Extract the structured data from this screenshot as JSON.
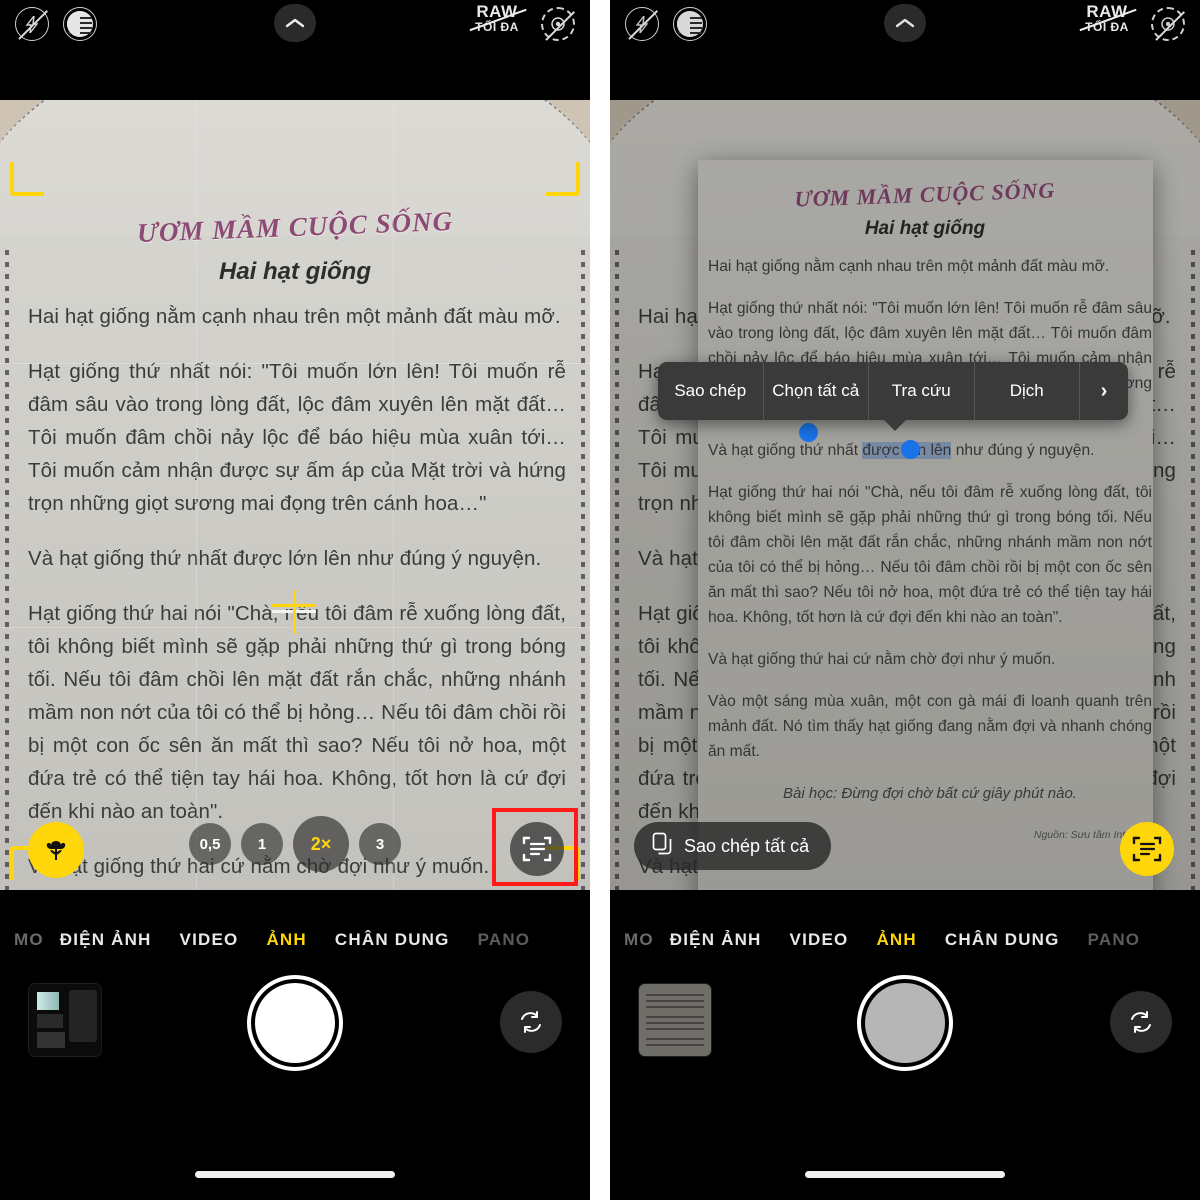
{
  "app": {
    "name": "Camera",
    "accent_yellow": "#FFD60A",
    "selection_blue": "#1A73E8",
    "highlight_red": "#FF1A1A"
  },
  "topbar": {
    "flash_off_icon": "flash-off-icon",
    "night_mode_icon": "night-mode-icon",
    "chevron_up_icon": "chevron-up-icon",
    "raw_line1": "RAW",
    "raw_line2": "TỐI ĐA",
    "live_photo_off_icon": "live-photo-off-icon"
  },
  "document": {
    "banner": "ƯƠM MẦM CUỘC SỐNG",
    "title": "Hai hạt giống",
    "paragraphs": [
      "Hai hạt giống nằm cạnh nhau trên một mảnh đất màu mỡ.",
      "Hạt giống thứ nhất nói: \"Tôi muốn lớn lên! Tôi muốn rễ đâm sâu vào trong lòng đất, lộc đâm xuyên lên mặt đất… Tôi muốn đâm chồi nảy lộc để báo hiệu mùa xuân tới… Tôi muốn cảm nhận được sự ấm áp của Mặt trời và hứng trọn những giọt sương mai đọng trên cánh hoa…\"",
      "Và hạt giống thứ nhất được lớn lên như đúng ý nguyện.",
      "Hạt giống thứ hai nói \"Chà, nếu tôi đâm rễ xuống lòng đất, tôi không biết mình sẽ gặp phải những thứ gì trong bóng tối. Nếu tôi đâm chồi lên mặt đất rắn chắc, những nhánh mầm non nớt của tôi có thể bị hỏng… Nếu tôi đâm chồi rồi bị một con ốc sên ăn mất thì sao? Nếu tôi nở hoa, một đứa trẻ có thể tiện tay hái hoa. Không, tốt hơn là cứ đợi đến khi nào an toàn\".",
      "Và hạt giống thứ hai cứ nằm chờ đợi như ý muốn.",
      "Vào một sáng mùa xuân, một con gà mái đi loanh quanh trên mảnh đất. Nó tìm thấy hạt giống đang nằm đợi và nhanh chóng ăn mất."
    ],
    "lesson": "Bài học: Đừng đợi chờ bất cứ giây phút nào.",
    "source": "Nguồn: Sưu tầm Internet."
  },
  "selection": {
    "before": "Và hạt giống thứ nhất ",
    "selected": "được lớn lên",
    "after": " như đúng ý nguyện."
  },
  "context_menu": {
    "items": [
      {
        "label": "Sao chép",
        "name": "menu-item-copy"
      },
      {
        "label": "Chọn tất cả",
        "name": "menu-item-select-all"
      },
      {
        "label": "Tra cứu",
        "name": "menu-item-look-up"
      },
      {
        "label": "Dịch",
        "name": "menu-item-translate"
      }
    ],
    "more_label": "›"
  },
  "copy_all": {
    "label": "Sao chép tất cả",
    "icon": "copy-icon"
  },
  "zoom_controls": {
    "levels": [
      {
        "label": "0,5",
        "active": false
      },
      {
        "label": "1",
        "active": false
      },
      {
        "label": "2×",
        "active": true
      },
      {
        "label": "3",
        "active": false
      }
    ],
    "macro_icon": "flower-macro-icon",
    "scan_text_icon": "live-text-scan-icon"
  },
  "mode_strip": {
    "overflow_left": "MO",
    "modes": [
      {
        "label": "ĐIỆN ẢNH",
        "active": false
      },
      {
        "label": "VIDEO",
        "active": false
      },
      {
        "label": "ẢNH",
        "active": true
      },
      {
        "label": "CHÂN DUNG",
        "active": false
      },
      {
        "label": "PANO",
        "active": false,
        "dim": true
      }
    ]
  },
  "shutter_row": {
    "thumbnail_name": "last-photo-thumbnail",
    "shutter_name": "shutter-button",
    "flip_icon": "camera-flip-icon"
  },
  "panels": {
    "left_name": "camera-screen-before-scan",
    "right_name": "camera-screen-live-text-active"
  }
}
